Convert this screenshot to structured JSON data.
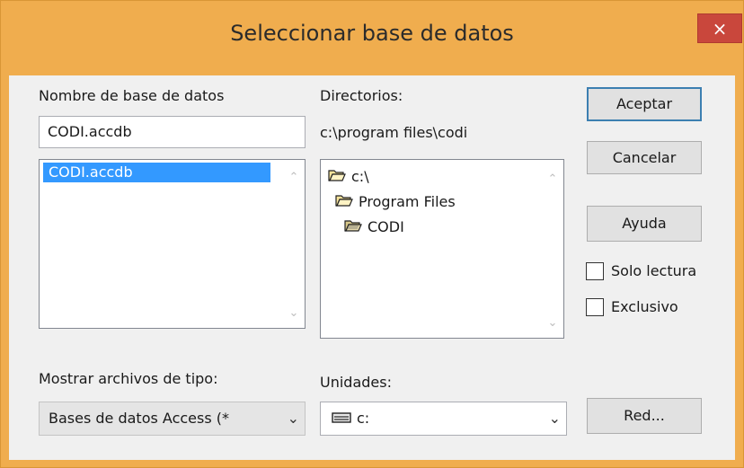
{
  "window": {
    "title": "Seleccionar base de datos",
    "close_glyph": "×"
  },
  "left": {
    "label": "Nombre de base de datos",
    "filename_value": "CODI.accdb",
    "files": [
      "CODI.accdb"
    ]
  },
  "middle": {
    "label": "Directorios:",
    "current_path": "c:\\program files\\codi",
    "tree": [
      {
        "label": "c:\\",
        "state": "open"
      },
      {
        "label": "Program Files",
        "state": "open"
      },
      {
        "label": "CODI",
        "state": "open-selected"
      }
    ]
  },
  "buttons": {
    "accept": "Aceptar",
    "cancel": "Cancelar",
    "help": "Ayuda",
    "network": "Red..."
  },
  "options": {
    "read_only": {
      "label": "Solo lectura",
      "checked": false
    },
    "exclusive": {
      "label": "Exclusivo",
      "checked": false
    }
  },
  "filetype": {
    "label": "Mostrar archivos de tipo:",
    "value": "Bases de datos Access (*"
  },
  "drives": {
    "label": "Unidades:",
    "value": "c:",
    "icon": "drive-icon"
  },
  "colors": {
    "accent": "#f0ad4e",
    "selection": "#3399ff",
    "close": "#c9473c"
  }
}
